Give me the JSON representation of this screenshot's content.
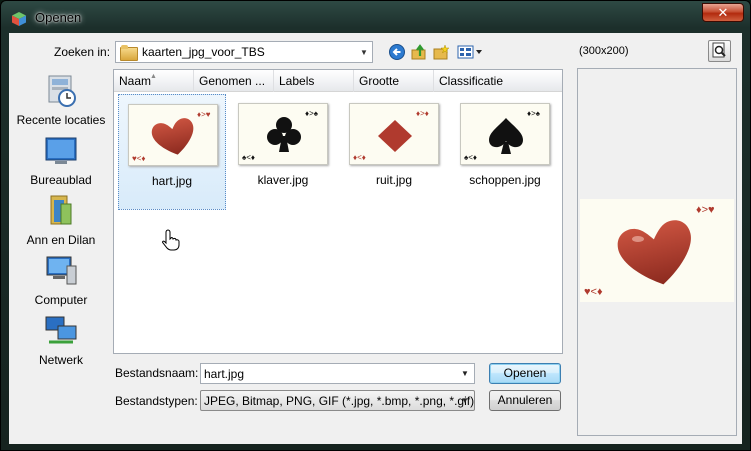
{
  "window": {
    "title": "Openen",
    "close_label": "✕"
  },
  "lookin": {
    "label": "Zoeken in:",
    "folder": "kaarten_jpg_voor_TBS"
  },
  "places": [
    {
      "label": "Recente locaties",
      "icon": "recent-locations-icon"
    },
    {
      "label": "Bureaublad",
      "icon": "desktop-icon"
    },
    {
      "label": "Ann en Dilan",
      "icon": "user-folder-icon"
    },
    {
      "label": "Computer",
      "icon": "computer-icon"
    },
    {
      "label": "Netwerk",
      "icon": "network-icon"
    }
  ],
  "columns": [
    "Naam",
    "Genomen ...",
    "Labels",
    "Grootte",
    "Classificatie"
  ],
  "files": [
    {
      "name": "hart.jpg",
      "suit": "heart",
      "top_corner": "♦>♥",
      "bottom_corner": "♥<♦",
      "selected": true
    },
    {
      "name": "klaver.jpg",
      "suit": "club",
      "top_corner": "♦>♠",
      "bottom_corner": "♠<♦",
      "selected": false
    },
    {
      "name": "ruit.jpg",
      "suit": "diamond",
      "top_corner": "♦>♦",
      "bottom_corner": "♦<♦",
      "selected": false
    },
    {
      "name": "schoppen.jpg",
      "suit": "spade",
      "top_corner": "♦>♠",
      "bottom_corner": "♠<♦",
      "selected": false
    }
  ],
  "filename": {
    "label": "Bestandsnaam:",
    "value": "hart.jpg"
  },
  "filetype": {
    "label": "Bestandstypen:",
    "value": "JPEG, Bitmap, PNG, GIF (*.jpg, *.bmp, *.png, *.gif)"
  },
  "buttons": {
    "open": "Openen",
    "cancel": "Annuleren"
  },
  "preview": {
    "size_label": "(300x200)"
  },
  "colors": {
    "heart": "#b03a2e",
    "suit_black": "#111111",
    "card_bg": "#fdfcf2",
    "selection": "#d8ebfa"
  }
}
